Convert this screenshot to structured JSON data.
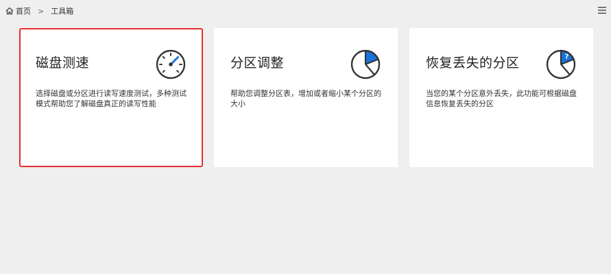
{
  "breadcrumb": {
    "home": "首页",
    "separator": ">",
    "current": "工具箱"
  },
  "icons": {
    "home": "home-icon",
    "menu": "hamburger-menu-icon",
    "speed": "speedometer-icon",
    "partition": "pie-partition-icon",
    "recover": "pie-question-icon"
  },
  "colors": {
    "accent": "#1a73d9",
    "selected_border": "#e62e2e",
    "card_bg": "#ffffff",
    "page_bg": "#efefef"
  },
  "cards": [
    {
      "title": "磁盘测速",
      "desc": "选择磁盘或分区进行读写速度测试，多种测试模式帮助您了解磁盘真正的读写性能",
      "selected": true
    },
    {
      "title": "分区调整",
      "desc": "帮助您调整分区表，增加或者缩小某个分区的大小",
      "selected": false
    },
    {
      "title": "恢复丢失的分区",
      "desc": "当您的某个分区意外丢失，此功能可根据磁盘信息恢复丢失的分区",
      "selected": false
    }
  ]
}
